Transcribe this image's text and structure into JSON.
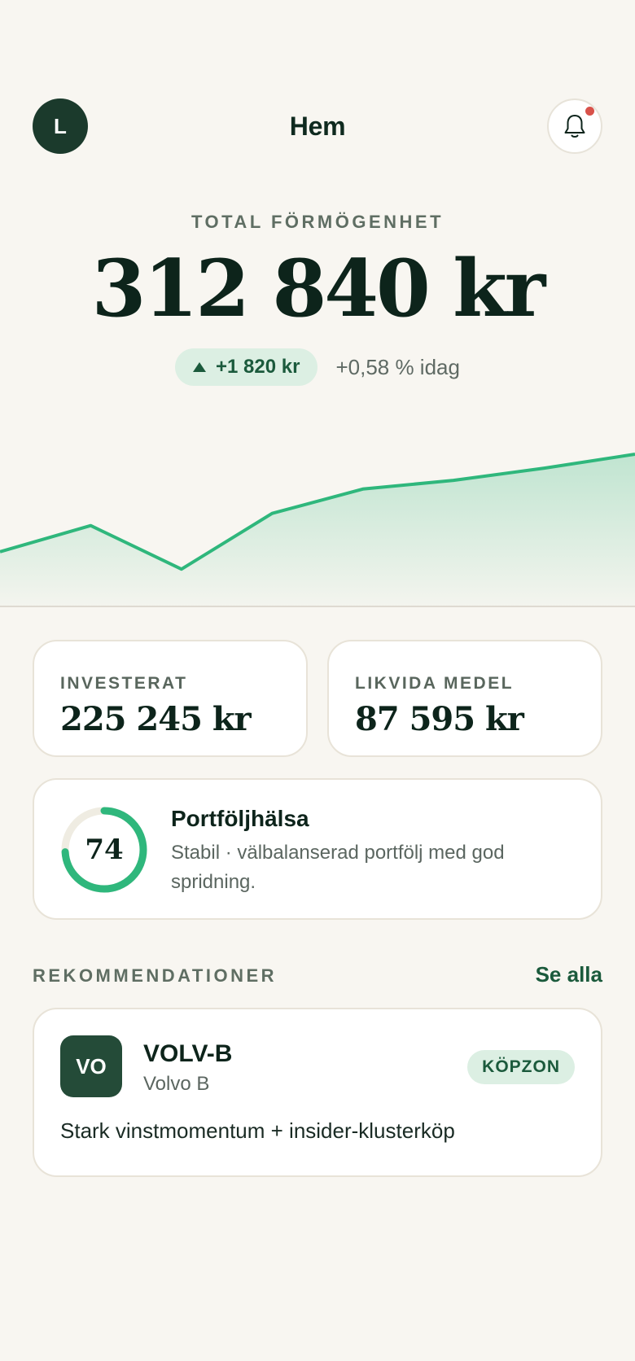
{
  "header": {
    "avatar_initial": "L",
    "title": "Hem"
  },
  "summary": {
    "label": "TOTAL FÖRMÖGENHET",
    "value": "312 840 kr",
    "change_amount": "+1 820 kr",
    "change_percent": "+0,58 % idag",
    "trend": [
      0.3,
      0.45,
      0.2,
      0.52,
      0.66,
      0.71,
      0.78,
      0.86
    ]
  },
  "stats": {
    "invested": {
      "label": "INVESTERAT",
      "value": "225 245 kr"
    },
    "cash": {
      "label": "LIKVIDA MEDEL",
      "value": "87 595 kr"
    }
  },
  "health": {
    "score": "74",
    "progress": 0.74,
    "title": "Portföljhälsa",
    "description": "Stabil · välbalanserad portfölj med god spridning."
  },
  "recommendations": {
    "section_label": "REKOMMENDATIONER",
    "see_all": "Se alla",
    "items": [
      {
        "logo": "VO",
        "ticker": "VOLV-B",
        "name": "Volvo B",
        "badge": "KÖPZON",
        "reason": "Stark vinstmomentum + insider-klusterköp"
      }
    ]
  },
  "colors": {
    "accent": "#2fb77c",
    "dark_green": "#1b3a2c",
    "background": "#f8f6f1",
    "notification": "#d8524a"
  },
  "icons": [
    "bell-icon",
    "arrow-up-icon"
  ]
}
